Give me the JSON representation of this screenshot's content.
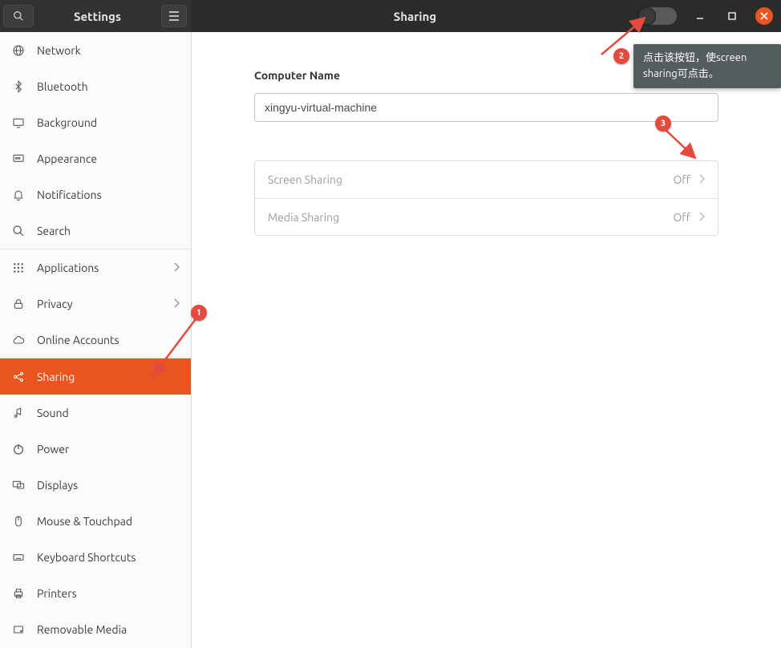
{
  "header": {
    "settings_title": "Settings",
    "page_title": "Sharing"
  },
  "sidebar": {
    "items": [
      {
        "id": "network",
        "label": "Network",
        "icon": "globe"
      },
      {
        "id": "bluetooth",
        "label": "Bluetooth",
        "icon": "bluetooth"
      },
      {
        "id": "background",
        "label": "Background",
        "icon": "display"
      },
      {
        "id": "appearance",
        "label": "Appearance",
        "icon": "appearance"
      },
      {
        "id": "notifications",
        "label": "Notifications",
        "icon": "bell"
      },
      {
        "id": "search",
        "label": "Search",
        "icon": "search"
      },
      {
        "id": "applications",
        "label": "Applications",
        "icon": "apps",
        "chevron": true
      },
      {
        "id": "privacy",
        "label": "Privacy",
        "icon": "lock",
        "chevron": true
      },
      {
        "id": "online",
        "label": "Online Accounts",
        "icon": "cloud"
      },
      {
        "id": "sharing",
        "label": "Sharing",
        "icon": "share",
        "active": true
      },
      {
        "id": "sound",
        "label": "Sound",
        "icon": "sound"
      },
      {
        "id": "power",
        "label": "Power",
        "icon": "power"
      },
      {
        "id": "displays",
        "label": "Displays",
        "icon": "displays"
      },
      {
        "id": "mouse",
        "label": "Mouse & Touchpad",
        "icon": "mouse"
      },
      {
        "id": "keyboard",
        "label": "Keyboard Shortcuts",
        "icon": "keyboard"
      },
      {
        "id": "printers",
        "label": "Printers",
        "icon": "printer"
      },
      {
        "id": "removable",
        "label": "Removable Media",
        "icon": "disk"
      }
    ]
  },
  "content": {
    "computer_name_label": "Computer Name",
    "computer_name_value": "xingyu-virtual-machine",
    "rows": [
      {
        "label": "Screen Sharing",
        "status": "Off"
      },
      {
        "label": "Media Sharing",
        "status": "Off"
      }
    ]
  },
  "annotations": {
    "badge1": "1",
    "badge2": "2",
    "badge3": "3",
    "tooltip": "点击该按钮，使screen sharing可点击。"
  }
}
